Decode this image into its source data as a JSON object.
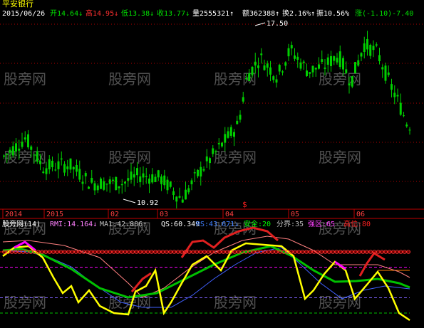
{
  "stock": {
    "name": "平安银行",
    "date": "2015/06/26",
    "open_label": "开",
    "open": "14.64",
    "open_arrow": "↓",
    "high_label": "高",
    "high": "14.95",
    "high_arrow": "↓",
    "low_label": "低",
    "low": "13.38",
    "low_arrow": "↓",
    "close_label": "收",
    "close": "13.77",
    "close_arrow": "↓",
    "volume_label": "量",
    "volume": "2555321",
    "volume_arrow": "↑",
    "amount_label": "额",
    "amount": "362388",
    "amount_arrow": "↑",
    "turnover_label": "换",
    "turnover": "2.16%",
    "turnover_arrow": "↑",
    "amplitude_label": "振",
    "amplitude": "10.56%",
    "change_label": "涨",
    "change": "(-1.10)-7.40"
  },
  "watermark": "股旁网",
  "price_annotations": {
    "max": "17.50",
    "min": "10.92"
  },
  "event_marker": "$",
  "time_axis": [
    "2014",
    "2015",
    "02",
    "03",
    "04",
    "05",
    "06"
  ],
  "indicator": {
    "title": "股旁网(14)",
    "values": [
      {
        "name": "RMI",
        "value": "14.164",
        "arrow": "↓"
      },
      {
        "name": "MA1",
        "value": "42.886",
        "arrow": "↑"
      },
      {
        "name": "QS",
        "value": "60.349",
        "arrow": ""
      },
      {
        "name": "RS",
        "value": "43.671",
        "arrow": "↓"
      },
      {
        "name": "安全",
        "value": "20",
        "arrow": ""
      },
      {
        "name": "分界",
        "value": "35",
        "arrow": ""
      },
      {
        "name": "强区",
        "value": "65",
        "arrow": ""
      },
      {
        "name": "高位",
        "value": "80",
        "arrow": ""
      }
    ]
  },
  "colors": {
    "background": "#000000",
    "up_candle": "#00d000",
    "down_candle": "#00d000",
    "price_grid": "#b00000",
    "axis_text": "#ff4040",
    "header_text": "#c0c0c0",
    "stock_name": "#ffff00",
    "date": "#ffffff",
    "open": "#00e000",
    "high": "#ff3030",
    "low": "#00e000",
    "close": "#00e000",
    "volume": "#ffffff",
    "change": "#00e000",
    "watermark": "#505050",
    "rmi_line": "#ffff00",
    "rs_line": "#4060ff",
    "ma1_line": "#00c000",
    "qs_line": "#ff8080",
    "band_line": "#e02020",
    "band_circles": "#ff3030",
    "safe_line": "#00c000",
    "divider_line": "#8060ff",
    "strong_line": "#ff00ff",
    "high_line": "#ff0000",
    "orange_line": "#ff8000",
    "axis_line": "#c00000",
    "indicator_title": "#ffffff",
    "rmi_label": "#ff80ff",
    "ma1_label": "#c0c0c0",
    "qs_label": "#ffffff",
    "rs_label": "#4080ff",
    "safe_label": "#00ff00",
    "div_label": "#c0c0c0",
    "strong_label": "#ff40ff",
    "high_label": "#ff2020"
  }
}
